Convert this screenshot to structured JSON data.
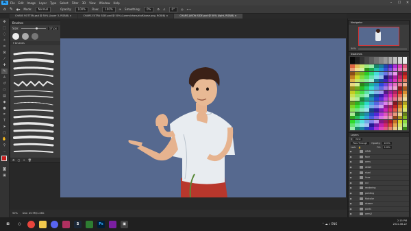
{
  "app": {
    "logo": "Ps"
  },
  "menu": [
    "File",
    "Edit",
    "Image",
    "Layer",
    "Type",
    "Select",
    "Filter",
    "3D",
    "View",
    "Window",
    "Help"
  ],
  "window_controls": {
    "minimize": "–",
    "maximize": "☐",
    "close": "✕"
  },
  "options": {
    "mode_label": "Mode:",
    "mode_value": "Normal",
    "opacity_label": "Opacity:",
    "opacity_value": "100%",
    "flow_label": "Flow:",
    "flow_value": "100%",
    "smoothing_label": "Smoothing:",
    "smoothing_value": "0%",
    "angle_value": "0°"
  },
  "tabs": [
    {
      "label": "CHARS ROTTEN.psd @ 50% (Layer 3, RGB/8)",
      "close": "×"
    },
    {
      "label": "CHARS EXTRA SIDE.psd @ 50% (Lorem/chars/stuff/pose.png, RGB/8)",
      "close": "×"
    },
    {
      "label": "CHARS JASON SIDE.psd @ 50% (light, RGB/8)",
      "close": "×"
    }
  ],
  "brushes": {
    "title": "Brushes",
    "size_label": "Size:",
    "size_value": "17 px",
    "group_label": "brushes"
  },
  "status": {
    "zoom": "50%",
    "doc": "Doc: 45.9M/1.46G"
  },
  "navigator": {
    "title": "Navigator",
    "zoom": "50%"
  },
  "swatches": {
    "title": "Swatches"
  },
  "layers": {
    "title": "Layers",
    "filter_label": "Kind",
    "blend": "Pass Through",
    "opacity_label": "Opacity:",
    "opacity_value": "100%",
    "lock_label": "Lock:",
    "fill_label": "Fill:",
    "fill_value": "100%",
    "rows": [
      "GRID",
      "face",
      "arms",
      "detail",
      "shad",
      "lines",
      "col",
      "rendering",
      "painting",
      "flatcolor",
      "drawer",
      "pants",
      "arms2",
      "light"
    ]
  },
  "taskbar": {
    "time": "2:15 PM",
    "date": "2022-08-22",
    "lang": "ENG"
  },
  "colors": {
    "accent": "#31a8ff",
    "canvas_bg": "#56698f",
    "shirt": "#e8ecf0",
    "pants": "#b8372c"
  }
}
